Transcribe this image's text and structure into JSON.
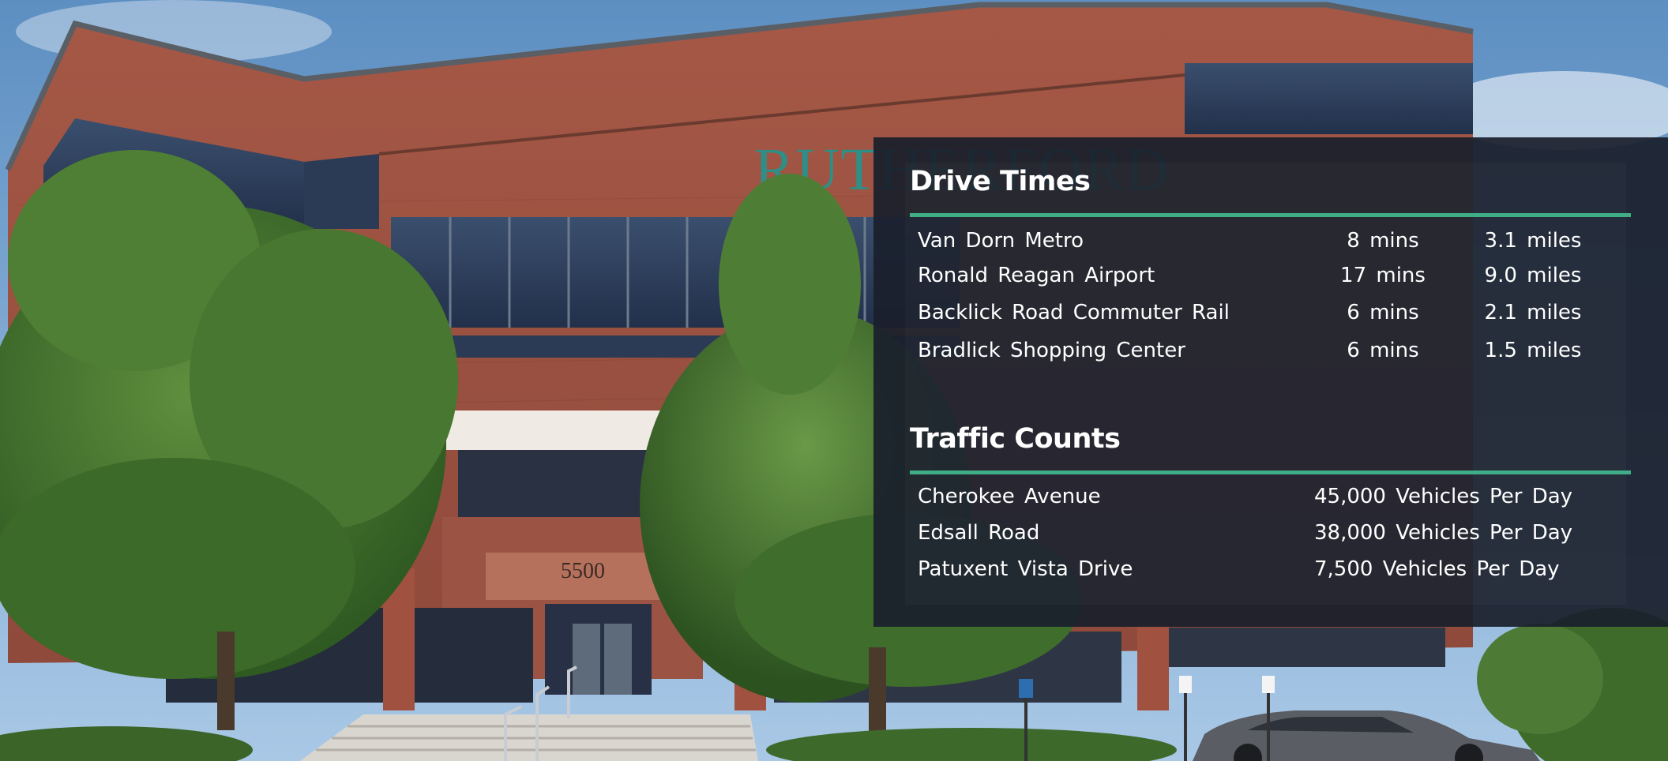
{
  "building": {
    "sign": "RUTHERFORD",
    "address_number": "5500"
  },
  "drive_times": {
    "title": "Drive Times",
    "rows": [
      {
        "place": "Van Dorn Metro",
        "time": "8 mins",
        "distance": "3.1 miles"
      },
      {
        "place": "Ronald Reagan Airport",
        "time": "17 mins",
        "distance": "9.0 miles"
      },
      {
        "place": "Backlick Road Commuter Rail",
        "time": "6 mins",
        "distance": "2.1 miles"
      },
      {
        "place": "Bradlick Shopping Center",
        "time": "6 mins",
        "distance": "1.5 miles"
      }
    ]
  },
  "traffic_counts": {
    "title": "Traffic Counts",
    "rows": [
      {
        "road": "Cherokee Avenue",
        "count": "45,000 Vehicles Per Day"
      },
      {
        "road": "Edsall Road",
        "count": "38,000 Vehicles Per Day"
      },
      {
        "road": "Patuxent Vista Drive",
        "count": "7,500 Vehicles Per Day"
      }
    ]
  },
  "colors": {
    "accent": "#3fae87",
    "panel": "#1a1f2c",
    "brick": "#9c4f3f",
    "sky": "#6f9fcb"
  }
}
